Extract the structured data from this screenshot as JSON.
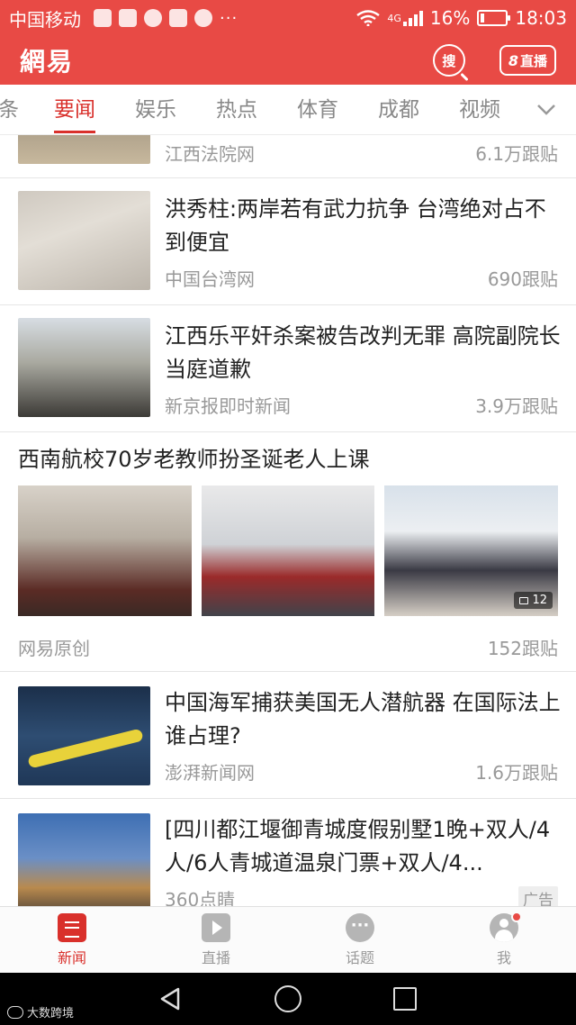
{
  "status_bar": {
    "carrier": "中国移动",
    "network": "4G",
    "battery": "16%",
    "battery_level": 0.16,
    "time": "18:03",
    "more": "···"
  },
  "header": {
    "logo": "網易",
    "search_label": "搜",
    "live_count": "8",
    "live_label": "直播"
  },
  "tabs": [
    {
      "label": "条"
    },
    {
      "label": "要闻",
      "active": true
    },
    {
      "label": "娱乐"
    },
    {
      "label": "热点"
    },
    {
      "label": "体育"
    },
    {
      "label": "成都"
    },
    {
      "label": "视频"
    }
  ],
  "feed": {
    "items": [
      {
        "source": "江西法院网",
        "count": "6.1万跟贴"
      },
      {
        "title": "洪秀柱:两岸若有武力抗争 台湾绝对占不到便宜",
        "source": "中国台湾网",
        "count": "690跟贴"
      },
      {
        "title": "江西乐平奸杀案被告改判无罪 高院副院长当庭道歉",
        "source": "新京报即时新闻",
        "count": "3.9万跟贴"
      },
      {
        "title": "西南航校70岁老教师扮圣诞老人上课",
        "source": "网易原创",
        "count": "152跟贴",
        "photo_count": "12"
      },
      {
        "title": "中国海军捕获美国无人潜航器 在国际法上谁占理?",
        "source": "澎湃新闻网",
        "count": "1.6万跟贴"
      },
      {
        "title": "[四川都江堰御青城度假别墅1晚+双人/4人/6人青城道温泉门票+双人/4...",
        "source": "360点睛",
        "tag": "广告"
      }
    ]
  },
  "bottom_nav": [
    {
      "label": "新闻",
      "icon": "news-icon",
      "active": true
    },
    {
      "label": "直播",
      "icon": "play-icon"
    },
    {
      "label": "话题",
      "icon": "chat-icon"
    },
    {
      "label": "我",
      "icon": "user-icon"
    }
  ],
  "watermark": "大数跨境",
  "colors": {
    "brand_red": "#e84a45",
    "active_tab": "#d9302b",
    "muted_text": "#999999"
  }
}
